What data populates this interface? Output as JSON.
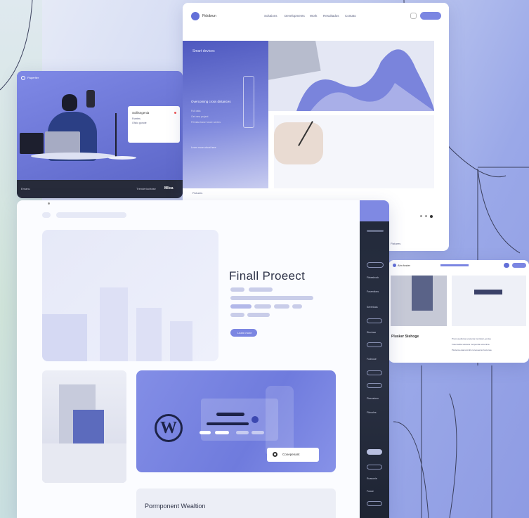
{
  "top_site": {
    "brand": "Fidobrun",
    "nav": [
      "Solutions",
      "Developments",
      "Work",
      "Resultados",
      "Contato"
    ],
    "hero_title": "Smart devices",
    "hero_lines": [
      "Overcoming cross distances",
      "Full data",
      "Get new project",
      "Fill data base future sentes"
    ],
    "hero_link": "Learn more about here",
    "footer_text": "Fictures",
    "grid_text": "Fistures"
  },
  "left_site": {
    "logo": "Paperfier",
    "box_title": "Sollisngenia",
    "box_lines": [
      "Fuertes",
      "Oficio gonote"
    ],
    "footer_left": "Emanu",
    "footer_right": "Trenderiocfrase",
    "footer_badge": "Mlica"
  },
  "main_site": {
    "title": "Finall Proeect",
    "button": "Learn more",
    "sidebar_items": [
      "Fitnesbook",
      "Fosentions",
      "Serenlsas",
      "Sinvlose",
      "Fodnoue",
      "Piesnsionn",
      "Flizcoles",
      "Roasonie",
      "Fooue"
    ],
    "card_button": "Conepenant",
    "bottom_title": "Pormponent Wealtion"
  },
  "right_site": {
    "brand": "Alm fuster",
    "title": "Plusker Stehoge",
    "lines": [
      "Promosedisnta sorelenia trentisia Leonisa",
      "Fotemsidia solanoa morpentia aorentnia",
      "Pirelenia elamonimhs tureosenia frecionsa"
    ]
  },
  "colors": {
    "accent": "#7b86e2",
    "accent_dark": "#5c66c8",
    "ink": "#252a40",
    "sidebar": "#1e2433"
  }
}
